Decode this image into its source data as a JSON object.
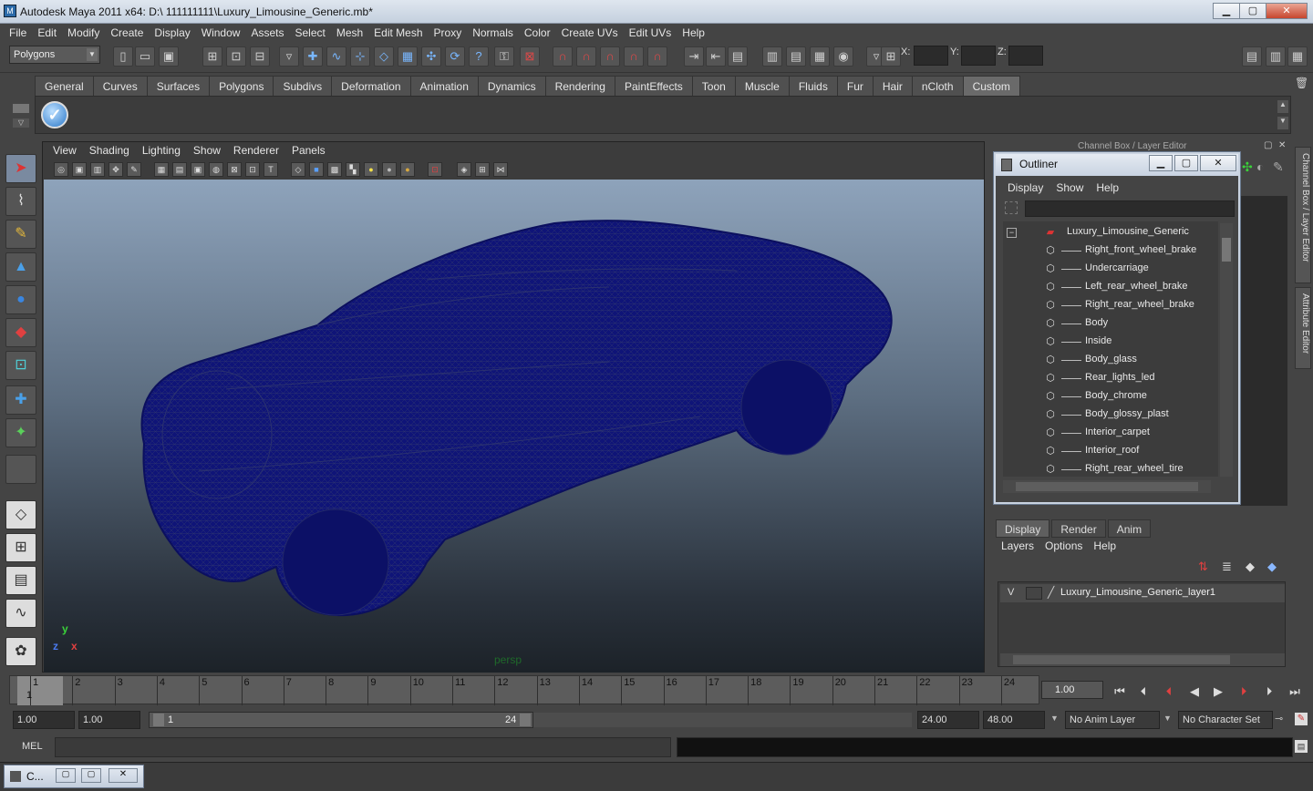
{
  "window": {
    "title": "Autodesk Maya 2011 x64: D:\\ 111111111\\Luxury_Limousine_Generic.mb*",
    "min": "▁",
    "max": "▢",
    "close": "✕"
  },
  "menubar": [
    "File",
    "Edit",
    "Modify",
    "Create",
    "Display",
    "Window",
    "Assets",
    "Select",
    "Mesh",
    "Edit Mesh",
    "Proxy",
    "Normals",
    "Color",
    "Create UVs",
    "Edit UVs",
    "Help"
  ],
  "toolbar": {
    "mode": "Polygons",
    "x_label": "X:",
    "y_label": "Y:",
    "z_label": "Z:"
  },
  "shelf": {
    "tabs": [
      "General",
      "Curves",
      "Surfaces",
      "Polygons",
      "Subdivs",
      "Deformation",
      "Animation",
      "Dynamics",
      "Rendering",
      "PaintEffects",
      "Toon",
      "Muscle",
      "Fluids",
      "Fur",
      "Hair",
      "nCloth",
      "Custom"
    ],
    "active_tab": "Custom"
  },
  "viewport": {
    "menu": [
      "View",
      "Shading",
      "Lighting",
      "Show",
      "Renderer",
      "Panels"
    ],
    "camera": "persp",
    "axis_x": "x",
    "axis_y": "y",
    "axis_z": "z",
    "wire_color": "#0f1478"
  },
  "channel_box": {
    "title": "Channel Box / Layer Editor"
  },
  "side_tabs": [
    "Channel Box / Layer Editor",
    "Attribute Editor"
  ],
  "outliner": {
    "title": "Outliner",
    "menu": [
      "Display",
      "Show",
      "Help"
    ],
    "root": "Luxury_Limousine_Generic",
    "items": [
      "Right_front_wheel_brake",
      "Undercarriage",
      "Left_rear_wheel_brake",
      "Right_rear_wheel_brake",
      "Body",
      "Inside",
      "Body_glass",
      "Rear_lights_led",
      "Body_chrome",
      "Body_glossy_plast",
      "Interior_carpet",
      "Interior_roof",
      "Right_rear_wheel_tire"
    ]
  },
  "layer_editor": {
    "tabs": [
      "Display",
      "Render",
      "Anim"
    ],
    "active_tab": "Display",
    "menu": [
      "Layers",
      "Options",
      "Help"
    ],
    "layer_visible": "V",
    "layer_name": "Luxury_Limousine_Generic_layer1"
  },
  "timeline": {
    "ticks": [
      "1",
      "2",
      "3",
      "4",
      "5",
      "6",
      "7",
      "8",
      "9",
      "10",
      "11",
      "12",
      "13",
      "14",
      "15",
      "16",
      "17",
      "18",
      "19",
      "20",
      "21",
      "22",
      "23",
      "24"
    ],
    "current_frame_label": "1",
    "current_time": "1.00"
  },
  "range": {
    "start": "1.00",
    "playback_start": "1.00",
    "slider_start": "1",
    "slider_end": "24",
    "playback_end": "24.00",
    "end": "48.00",
    "anim_layer": "No Anim Layer",
    "character_set": "No Character Set"
  },
  "command": {
    "label": "MEL"
  },
  "taskbar": {
    "window_label": "C..."
  }
}
